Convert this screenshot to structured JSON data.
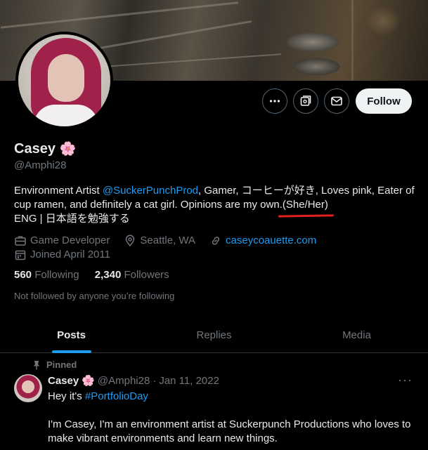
{
  "profile": {
    "name": "Casey",
    "name_emoji": "🌸",
    "handle": "@Amphi28",
    "follow_label": "Follow",
    "bio": {
      "part1": "Environment Artist ",
      "mention": "@SuckerPunchProd",
      "part2": ", Gamer, コーヒーが好き, Loves pink, Eater of cup ramen, and definitely a cat girl. Opinions are my own.",
      "pronouns": "(She/Her)",
      "line2": "ENG | 日本語を勉強する"
    },
    "meta": {
      "category": "Game Developer",
      "location": "Seattle, WA",
      "website": "caseycoauette.com",
      "joined": "Joined April 2011"
    },
    "following_count": "560",
    "following_label": "Following",
    "followers_count": "2,340",
    "followers_label": "Followers",
    "followed_by": "Not followed by anyone you’re following"
  },
  "tabs": [
    {
      "label": "Posts",
      "active": true
    },
    {
      "label": "Replies",
      "active": false
    },
    {
      "label": "Media",
      "active": false
    }
  ],
  "tweet": {
    "pinned_label": "Pinned",
    "name": "Casey",
    "name_emoji": "🌸",
    "handle": "@Amphi28",
    "separator": "·",
    "date": "Jan 11, 2022",
    "line1_prefix": "Hey it's ",
    "hashtag": "#PortfolioDay",
    "body": "I'm Casey, I'm an environment artist at Suckerpunch Productions who loves to make vibrant environments and learn new things.",
    "more": "···"
  },
  "colors": {
    "accent": "#1d9bf0",
    "background": "#000000",
    "text": "#e7e9ea",
    "muted": "#71767b",
    "annotation": "#e0201c"
  }
}
